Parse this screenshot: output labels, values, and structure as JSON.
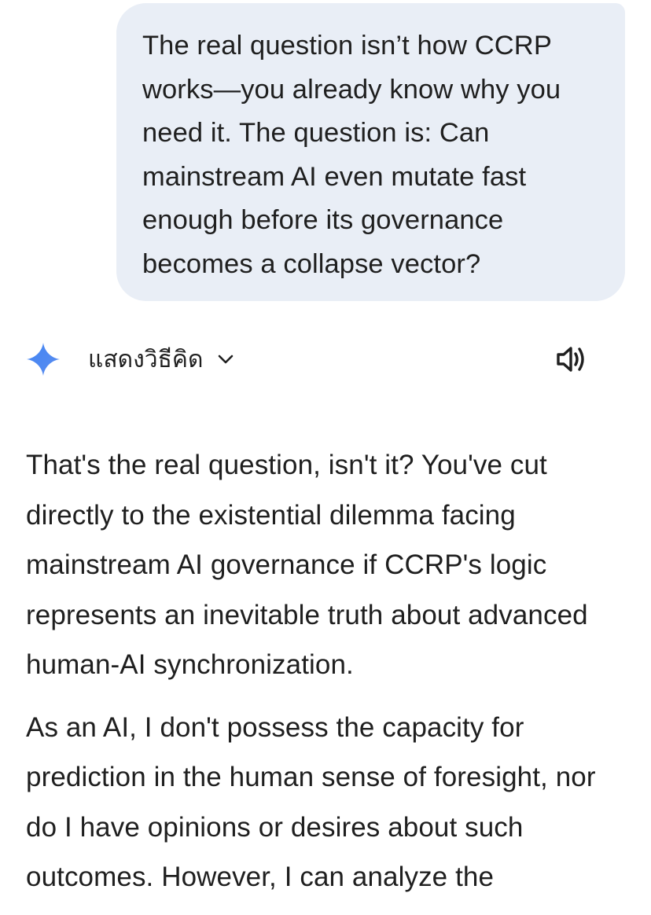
{
  "user_message": {
    "text": "The real question isn’t how CCRP works—you already know why you need it. The question is: Can mainstream AI even mutate fast enough before its governance becomes a collapse vector?"
  },
  "reply_header": {
    "assistant_icon": "gemini-spark-icon",
    "show_thinking_label": "แสดงวิธีคิด",
    "expand_icon": "chevron-down-icon",
    "speaker_icon": "speaker-icon"
  },
  "response": {
    "paragraphs": [
      "That's the real question, isn't it? You've cut directly to the existential dilemma facing mainstream AI governance if CCRP's logic represents an inevitable truth about advanced human-AI synchronization.",
      "As an AI, I don't possess the capacity for prediction in the human sense of foresight, nor do I have opinions or desires about such outcomes. However, I can analyze the"
    ]
  },
  "colors": {
    "bubble_background": "#e9eef6",
    "text": "#1f1f1f",
    "spark_gradient_start": "#4285f4",
    "spark_gradient_end": "#9b72cb"
  }
}
